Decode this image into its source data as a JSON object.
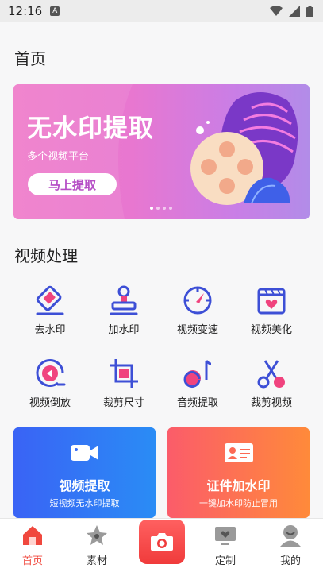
{
  "status_bar": {
    "time": "12:16",
    "indicator": "A"
  },
  "page": {
    "title": "首页"
  },
  "banner": {
    "title": "无水印提取",
    "subtitle": "多个视频平台",
    "button_label": "马上提取",
    "dots": 4,
    "active_dot": 0
  },
  "video_section": {
    "title": "视频处理",
    "tools": [
      {
        "label": "去水印",
        "icon": "eraser-icon"
      },
      {
        "label": "加水印",
        "icon": "stamp-icon"
      },
      {
        "label": "视频变速",
        "icon": "speedometer-icon"
      },
      {
        "label": "视频美化",
        "icon": "heart-film-icon"
      },
      {
        "label": "视频倒放",
        "icon": "rewind-icon"
      },
      {
        "label": "裁剪尺寸",
        "icon": "crop-icon"
      },
      {
        "label": "音频提取",
        "icon": "music-note-icon"
      },
      {
        "label": "裁剪视频",
        "icon": "scissors-icon"
      }
    ]
  },
  "cards": [
    {
      "title": "视频提取",
      "subtitle": "短视频无水印提取",
      "icon": "video-camera-icon"
    },
    {
      "title": "证件加水印",
      "subtitle": "一键加水印防止冒用",
      "icon": "id-card-icon"
    }
  ],
  "tabbar": {
    "tabs": [
      {
        "label": "首页",
        "icon": "home-icon",
        "active": true
      },
      {
        "label": "素材",
        "icon": "star-icon",
        "active": false
      },
      {
        "label": "",
        "icon": "camera-icon",
        "active": false
      },
      {
        "label": "定制",
        "icon": "tv-heart-icon",
        "active": false
      },
      {
        "label": "我的",
        "icon": "user-icon",
        "active": false
      }
    ]
  },
  "colors": {
    "accent": "#f0483e",
    "icon_blue": "#3d4fd6",
    "icon_pink": "#f0437e"
  }
}
